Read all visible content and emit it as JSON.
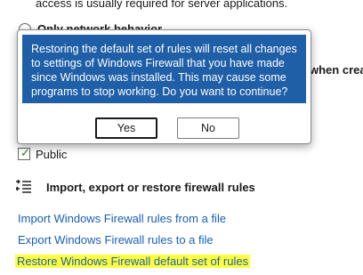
{
  "background": {
    "top_text": "access is usually required for server applications.",
    "radio_label_partial": "Only network behavior",
    "right_text_partial": "when creat",
    "public_label": "Public",
    "section_title": "Import, export or restore firewall rules",
    "links": {
      "import": "Import Windows Firewall rules from a file",
      "export": "Export Windows Firewall rules to a file",
      "restore": "Restore Windows Firewall default set of rules"
    },
    "icons": {
      "rules_icon": "list-arrows-icon",
      "check": "✓"
    }
  },
  "dialog": {
    "message": "Restoring the default set of rules will reset all changes to settings of Windows Firewall that you have made since Windows was installed. This may cause some programs to stop working. Do you want to continue?",
    "yes_label": "Yes",
    "no_label": "No"
  },
  "colors": {
    "dialog_message_bg": "#1e5fa8",
    "link": "#1a5fb4",
    "highlight": "#ffff3d"
  }
}
